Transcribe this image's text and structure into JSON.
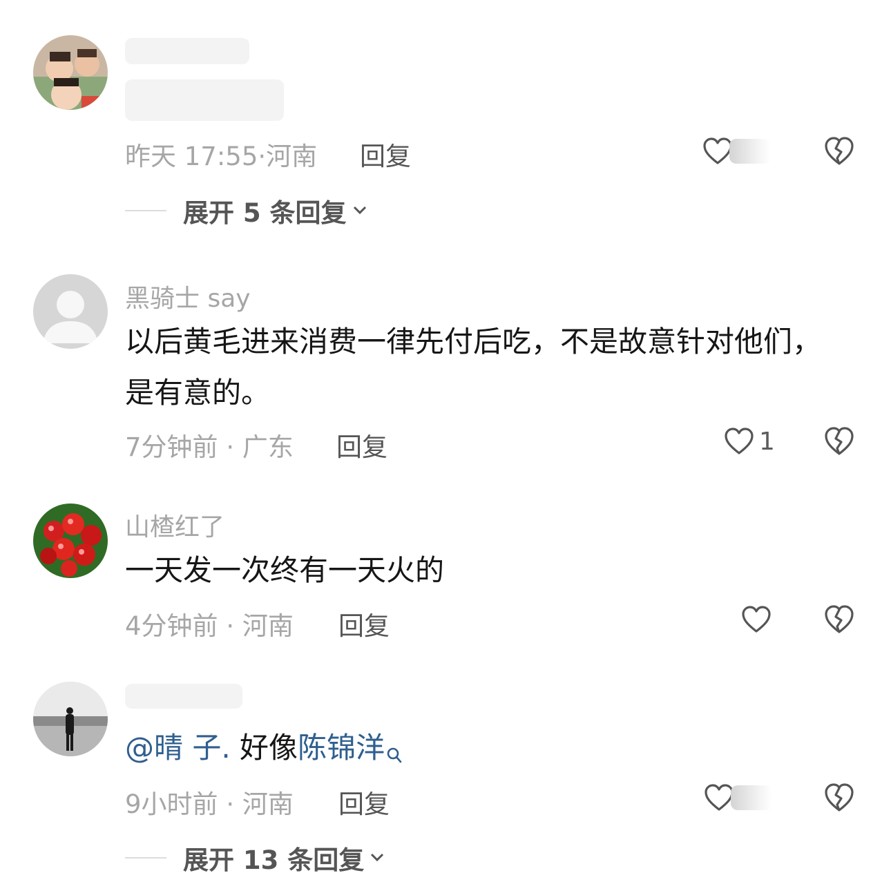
{
  "comments": [
    {
      "username": "",
      "content": "",
      "time": "昨天 17:55",
      "location": "河南",
      "reply_label": "回复",
      "like_count": "",
      "expand_label": "展开 5 条回复",
      "avatar_icon": "avatar-photo-children"
    },
    {
      "username": "黑骑士 say",
      "content": "以后黄毛进来消费一律先付后吃，不是故意针对他们，是有意的。",
      "time": "7分钟前",
      "location": "广东",
      "reply_label": "回复",
      "like_count": "1",
      "avatar_icon": "avatar-default-person"
    },
    {
      "username": "山楂红了",
      "content": "一天发一次终有一天火的",
      "time": "4分钟前",
      "location": "河南",
      "reply_label": "回复",
      "like_count": "",
      "avatar_icon": "avatar-photo-hawthorn-berries"
    },
    {
      "username": "",
      "content_mention": "@晴 子.",
      "content_text": " 好像",
      "content_link": "陈锦洋",
      "time": "9小时前",
      "location": "河南",
      "reply_label": "回复",
      "like_count": "",
      "expand_label": "展开 13 条回复",
      "avatar_icon": "avatar-photo-beach-person"
    }
  ],
  "meta_separator": "·",
  "colors": {
    "meta_gray": "#a6a6a6",
    "link_blue": "#2f5f8f",
    "text_dark": "#161616"
  }
}
